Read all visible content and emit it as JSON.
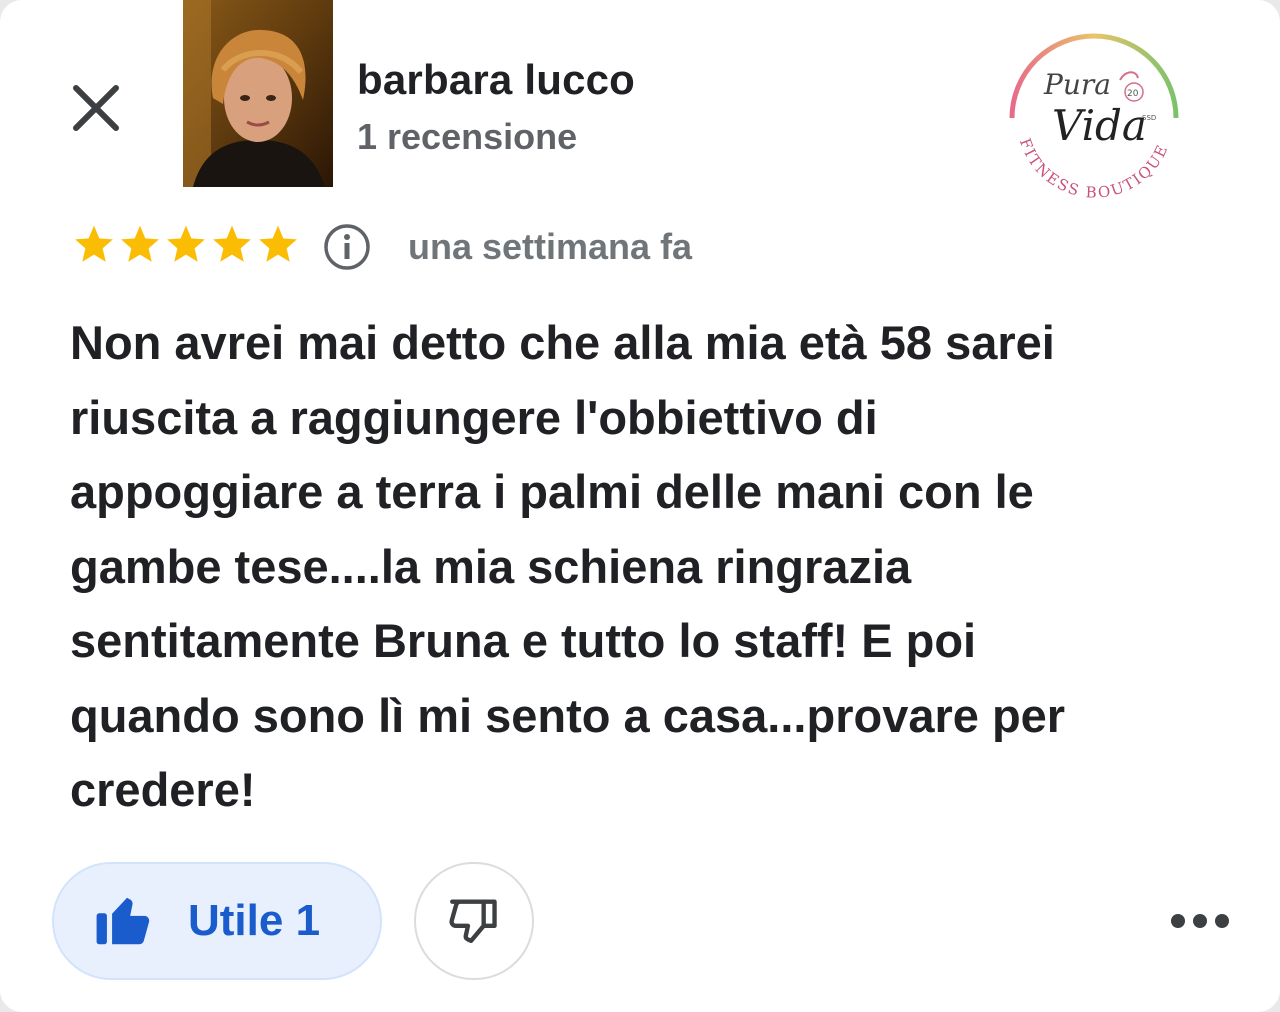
{
  "review": {
    "author_name": "barbara lucco",
    "review_count": "1 recensione",
    "rating": 5,
    "time_ago": "una settimana fa",
    "text_lines": [
      "Non avrei mai detto che alla mia età 58 sarei",
      "riuscita a raggiungere l'obbiettivo di",
      "appoggiare a terra i palmi delle mani con le",
      "gambe tese....la mia schiena ringrazia",
      "sentitamente Bruna e tutto lo staff! E poi",
      "quando sono lì mi sento a casa...provare per",
      "credere!"
    ]
  },
  "logo": {
    "line1": "Pura",
    "line2": "Vida",
    "arc_text": "FITNESS BOUTIQUE",
    "badge_year": "20",
    "badge_ssd": "SSD"
  },
  "actions": {
    "helpful_label": "Utile 1"
  },
  "icons": {
    "close": "close-icon",
    "star": "star-icon",
    "info": "info-icon",
    "thumbs_up": "thumbs-up-icon",
    "thumbs_down": "thumbs-down-icon",
    "more": "more-horizontal-icon"
  },
  "colors": {
    "star": "#fbbc04",
    "helpful_bg": "#e8f0fe",
    "helpful_text": "#1a5ccc",
    "secondary_text": "#5f6368"
  }
}
